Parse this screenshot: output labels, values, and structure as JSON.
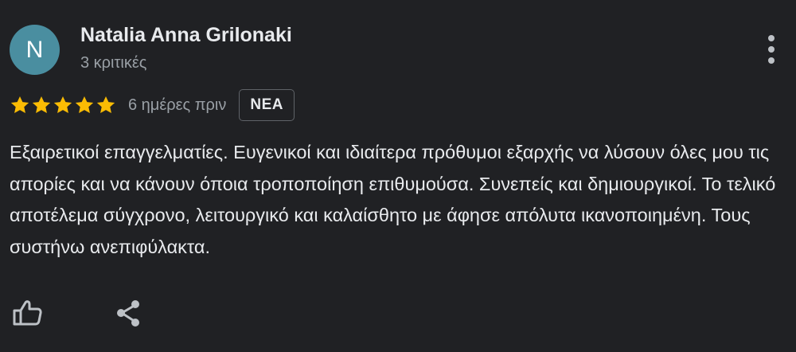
{
  "review": {
    "avatar_initial": "N",
    "avatar_color": "#4a8ea0",
    "author_name": "Natalia Anna Grilonaki",
    "author_meta": "3 κριτικές",
    "rating": 5,
    "rating_max": 5,
    "star_color": "#fbbc04",
    "date": "6 ημέρες πριν",
    "badge": "ΝΕΑ",
    "text": "Εξαιρετικοί επαγγελματίες. Ευγενικοί και ιδιαίτερα πρόθυμοι εξαρχής να λύσουν όλες μου τις απορίες και να κάνουν όποια τροποποίηση επιθυμούσα. Συνεπείς και δημιουργικοί. Το τελικό αποτέλεμα σύγχρονο, λειτουργικό και καλαίσθητο με άφησε απόλυτα ικανοποιημένη. Τους συστήνω ανεπιφύλακτα."
  },
  "icons": {
    "more": "more-vertical-icon",
    "like": "thumbs-up-icon",
    "share": "share-icon"
  }
}
